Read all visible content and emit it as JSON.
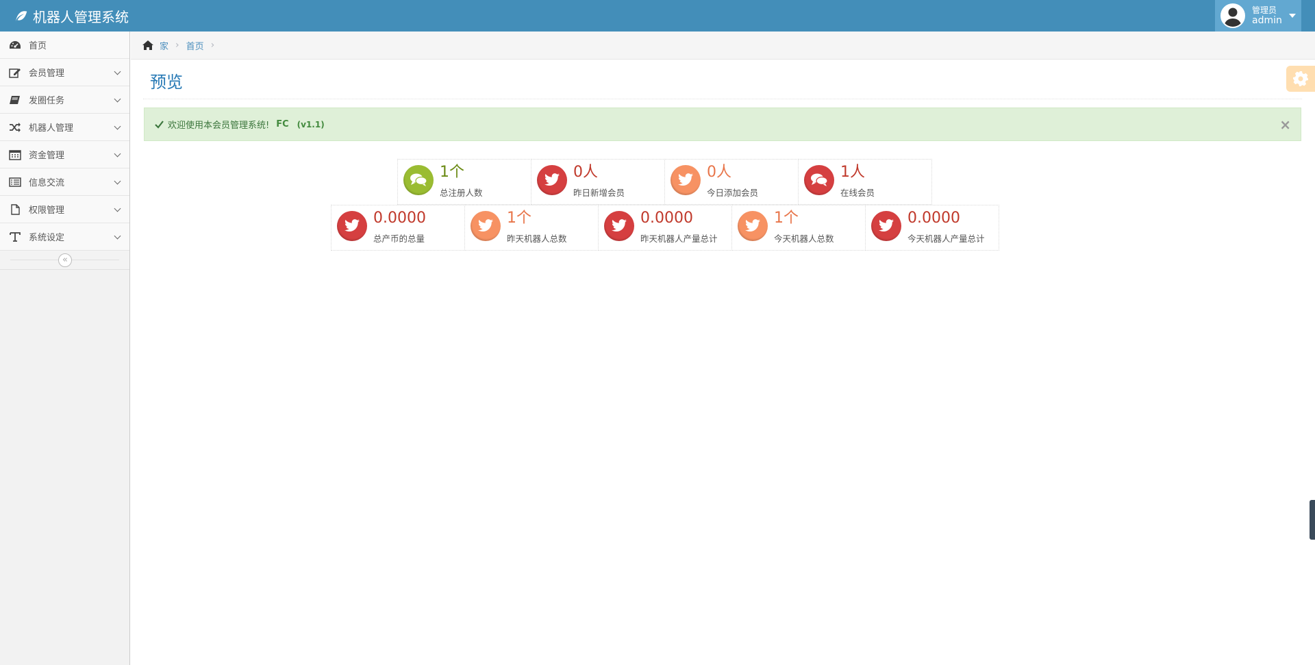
{
  "app": {
    "title": "机器人管理系统"
  },
  "user": {
    "welcome": "管理员",
    "name": "admin"
  },
  "sidebar": {
    "items": [
      {
        "label": "首页",
        "icon": "dashboard-icon"
      },
      {
        "label": "会员管理",
        "icon": "edit-icon"
      },
      {
        "label": "发圈任务",
        "icon": "book-icon"
      },
      {
        "label": "机器人管理",
        "icon": "random-icon"
      },
      {
        "label": "资金管理",
        "icon": "calendar-icon"
      },
      {
        "label": "信息交流",
        "icon": "list-alt-icon"
      },
      {
        "label": "权限管理",
        "icon": "file-icon"
      },
      {
        "label": "系统设定",
        "icon": "text-icon"
      }
    ],
    "collapse_glyph": "«"
  },
  "breadcrumb": {
    "home": "家",
    "current": "首页",
    "sep": "›"
  },
  "page": {
    "title": "预览"
  },
  "alert": {
    "text": "欢迎使用本会员管理系统!",
    "brand": "FC",
    "version": "(v1.1)",
    "close": "×"
  },
  "stats": {
    "row1": [
      {
        "value": "1个",
        "label": "总注册人数",
        "color": "green",
        "icon": "comments-icon"
      },
      {
        "value": "0人",
        "label": "昨日新增会员",
        "color": "red",
        "icon": "twitter-icon"
      },
      {
        "value": "0人",
        "label": "今日添加会员",
        "color": "orange",
        "icon": "twitter-icon"
      },
      {
        "value": "1人",
        "label": "在线会员",
        "color": "red",
        "icon": "comments-icon"
      }
    ],
    "row2": [
      {
        "value": "0.0000",
        "label": "总产币的总量",
        "color": "red",
        "icon": "twitter-icon"
      },
      {
        "value": "1个",
        "label": "昨天机器人总数",
        "color": "orange",
        "icon": "twitter-icon"
      },
      {
        "value": "0.0000",
        "label": "昨天机器人产量总计",
        "color": "red",
        "icon": "twitter-icon"
      },
      {
        "value": "1个",
        "label": "今天机器人总数",
        "color": "orange",
        "icon": "twitter-icon"
      },
      {
        "value": "0.0000",
        "label": "今天机器人产量总计",
        "color": "red",
        "icon": "twitter-icon"
      }
    ]
  },
  "colors": {
    "navbar": "#438eb9",
    "user_box": "#62a8d1",
    "green": "#9abc32",
    "red": "#d53f40",
    "orange": "#f79263",
    "title": "#2679b5"
  }
}
